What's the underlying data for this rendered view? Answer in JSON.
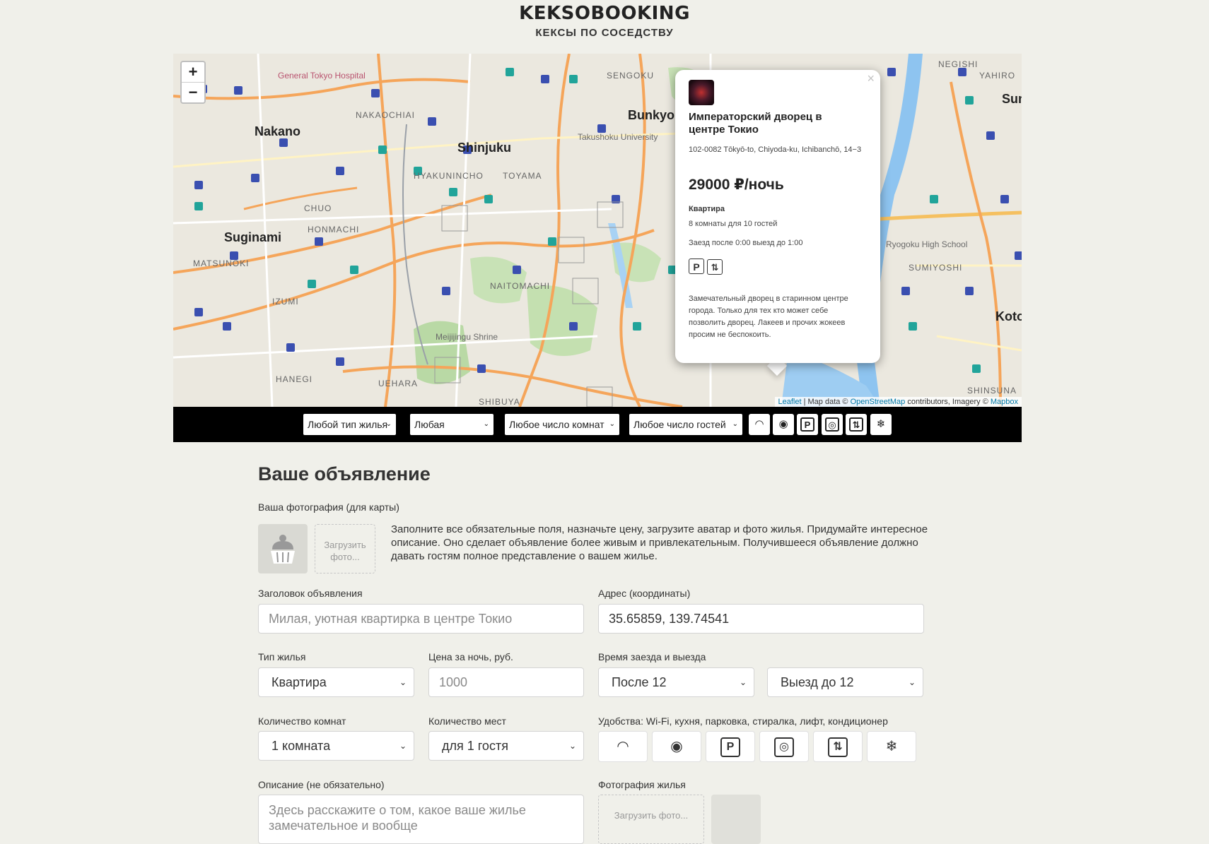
{
  "header": {
    "logo": "KEKSOBOOKING",
    "tagline": "КЕКСЫ ПО СОСЕДСТВУ"
  },
  "map": {
    "zoom_in": "+",
    "zoom_out": "−",
    "labels": {
      "nakano": "Nakano",
      "shinjuku": "Shinjuku",
      "suginami": "Suginami",
      "bunkyo": "Bunkyo",
      "koto": "Koto",
      "sum": "Sum",
      "hospital": "General Tokyo Hospital",
      "university": "Takushoku University",
      "shrine": "Meijijingu Shrine",
      "school": "Ryogoku High School",
      "chuo": "CHUO",
      "honmachi": "HONMACHI",
      "izumi": "IZUMI",
      "hanegi": "HANEGI",
      "uehara": "UEHARA",
      "shibuya": "SHIBUYA",
      "naitomachi": "NAITOMACHI",
      "sengoku": "SENGOKU",
      "negishi": "NEGISHI",
      "yahiro": "YAHIRO",
      "sumiyoshi": "SUMIYOSHI",
      "shinsuna": "SHINSUNA",
      "matsunoki": "MATSUNOKI",
      "nakaochiai": "NAKAOCHIAI",
      "hyakunincho": "HYAKUNINCHO",
      "toyama": "TOYAMA"
    },
    "attribution": {
      "leaflet": "Leaflet",
      "mapdata": " | Map data © ",
      "osm": "OpenStreetMap",
      "contrib": " contributors, Imagery © ",
      "mapbox": "Mapbox"
    }
  },
  "popup": {
    "close": "×",
    "title": "Императорский дворец в центре Токио",
    "address": "102-0082 Tōkyō-to, Chiyoda-ku, Ichibanchō, 14−3",
    "price": "29000 ₽/ночь",
    "type": "Квартира",
    "capacity": "8 комнаты для 10 гостей",
    "time": "Заезд после 0:00 выезд до 1:00",
    "features": [
      "P",
      "elevator-icon"
    ],
    "description": "Замечательный дворец в старинном центре города. Только для тех кто может себе позволить дворец. Лакеев и прочих жокеев просим не беспокоить."
  },
  "filters": {
    "type": "Любой тип жилья",
    "price": "Любая",
    "rooms": "Любое число комнат",
    "guests": "Любое число гостей",
    "features": [
      "wifi-icon",
      "dishwasher-icon",
      "parking-icon",
      "washer-icon",
      "elevator-icon",
      "conditioner-icon"
    ]
  },
  "form": {
    "title": "Ваше объявление",
    "avatar_label": "Ваша фотография (для карты)",
    "upload_avatar": "Загрузить фото...",
    "intro": "Заполните все обязательные поля, назначьте цену, загрузите аватар и фото жилья. Придумайте интересное описание. Оно сделает объявление более живым и привлекательным. Получившееся объявление должно давать гостям полное представление о вашем жилье.",
    "title_label": "Заголовок объявления",
    "title_placeholder": "Милая, уютная квартирка в центре Токио",
    "address_label": "Адрес (координаты)",
    "address_value": "35.65859, 139.74541",
    "type_label": "Тип жилья",
    "type_value": "Квартира",
    "price_label": "Цена за ночь, руб.",
    "price_placeholder": "1000",
    "time_label": "Время заезда и выезда",
    "checkin_value": "После 12",
    "checkout_value": "Выезд до 12",
    "rooms_label": "Количество комнат",
    "rooms_value": "1 комната",
    "capacity_label": "Количество мест",
    "capacity_value": "для 1 гостя",
    "features_label": "Удобства: Wi-Fi, кухня, парковка, стиралка, лифт, кондиционер",
    "description_label": "Описание (не обязательно)",
    "description_placeholder": "Здесь расскажите о том, какое ваше жилье замечательное и вообще",
    "photo_label": "Фотография жилья",
    "upload_photo": "Загрузить фото..."
  }
}
